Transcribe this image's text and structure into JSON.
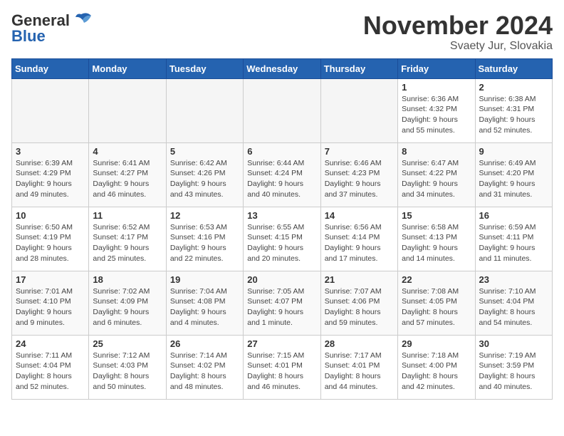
{
  "header": {
    "logo_general": "General",
    "logo_blue": "Blue",
    "month_title": "November 2024",
    "location": "Svaety Jur, Slovakia"
  },
  "weekdays": [
    "Sunday",
    "Monday",
    "Tuesday",
    "Wednesday",
    "Thursday",
    "Friday",
    "Saturday"
  ],
  "weeks": [
    [
      {
        "day": "",
        "info": ""
      },
      {
        "day": "",
        "info": ""
      },
      {
        "day": "",
        "info": ""
      },
      {
        "day": "",
        "info": ""
      },
      {
        "day": "",
        "info": ""
      },
      {
        "day": "1",
        "info": "Sunrise: 6:36 AM\nSunset: 4:32 PM\nDaylight: 9 hours\nand 55 minutes."
      },
      {
        "day": "2",
        "info": "Sunrise: 6:38 AM\nSunset: 4:31 PM\nDaylight: 9 hours\nand 52 minutes."
      }
    ],
    [
      {
        "day": "3",
        "info": "Sunrise: 6:39 AM\nSunset: 4:29 PM\nDaylight: 9 hours\nand 49 minutes."
      },
      {
        "day": "4",
        "info": "Sunrise: 6:41 AM\nSunset: 4:27 PM\nDaylight: 9 hours\nand 46 minutes."
      },
      {
        "day": "5",
        "info": "Sunrise: 6:42 AM\nSunset: 4:26 PM\nDaylight: 9 hours\nand 43 minutes."
      },
      {
        "day": "6",
        "info": "Sunrise: 6:44 AM\nSunset: 4:24 PM\nDaylight: 9 hours\nand 40 minutes."
      },
      {
        "day": "7",
        "info": "Sunrise: 6:46 AM\nSunset: 4:23 PM\nDaylight: 9 hours\nand 37 minutes."
      },
      {
        "day": "8",
        "info": "Sunrise: 6:47 AM\nSunset: 4:22 PM\nDaylight: 9 hours\nand 34 minutes."
      },
      {
        "day": "9",
        "info": "Sunrise: 6:49 AM\nSunset: 4:20 PM\nDaylight: 9 hours\nand 31 minutes."
      }
    ],
    [
      {
        "day": "10",
        "info": "Sunrise: 6:50 AM\nSunset: 4:19 PM\nDaylight: 9 hours\nand 28 minutes."
      },
      {
        "day": "11",
        "info": "Sunrise: 6:52 AM\nSunset: 4:17 PM\nDaylight: 9 hours\nand 25 minutes."
      },
      {
        "day": "12",
        "info": "Sunrise: 6:53 AM\nSunset: 4:16 PM\nDaylight: 9 hours\nand 22 minutes."
      },
      {
        "day": "13",
        "info": "Sunrise: 6:55 AM\nSunset: 4:15 PM\nDaylight: 9 hours\nand 20 minutes."
      },
      {
        "day": "14",
        "info": "Sunrise: 6:56 AM\nSunset: 4:14 PM\nDaylight: 9 hours\nand 17 minutes."
      },
      {
        "day": "15",
        "info": "Sunrise: 6:58 AM\nSunset: 4:13 PM\nDaylight: 9 hours\nand 14 minutes."
      },
      {
        "day": "16",
        "info": "Sunrise: 6:59 AM\nSunset: 4:11 PM\nDaylight: 9 hours\nand 11 minutes."
      }
    ],
    [
      {
        "day": "17",
        "info": "Sunrise: 7:01 AM\nSunset: 4:10 PM\nDaylight: 9 hours\nand 9 minutes."
      },
      {
        "day": "18",
        "info": "Sunrise: 7:02 AM\nSunset: 4:09 PM\nDaylight: 9 hours\nand 6 minutes."
      },
      {
        "day": "19",
        "info": "Sunrise: 7:04 AM\nSunset: 4:08 PM\nDaylight: 9 hours\nand 4 minutes."
      },
      {
        "day": "20",
        "info": "Sunrise: 7:05 AM\nSunset: 4:07 PM\nDaylight: 9 hours\nand 1 minute."
      },
      {
        "day": "21",
        "info": "Sunrise: 7:07 AM\nSunset: 4:06 PM\nDaylight: 8 hours\nand 59 minutes."
      },
      {
        "day": "22",
        "info": "Sunrise: 7:08 AM\nSunset: 4:05 PM\nDaylight: 8 hours\nand 57 minutes."
      },
      {
        "day": "23",
        "info": "Sunrise: 7:10 AM\nSunset: 4:04 PM\nDaylight: 8 hours\nand 54 minutes."
      }
    ],
    [
      {
        "day": "24",
        "info": "Sunrise: 7:11 AM\nSunset: 4:04 PM\nDaylight: 8 hours\nand 52 minutes."
      },
      {
        "day": "25",
        "info": "Sunrise: 7:12 AM\nSunset: 4:03 PM\nDaylight: 8 hours\nand 50 minutes."
      },
      {
        "day": "26",
        "info": "Sunrise: 7:14 AM\nSunset: 4:02 PM\nDaylight: 8 hours\nand 48 minutes."
      },
      {
        "day": "27",
        "info": "Sunrise: 7:15 AM\nSunset: 4:01 PM\nDaylight: 8 hours\nand 46 minutes."
      },
      {
        "day": "28",
        "info": "Sunrise: 7:17 AM\nSunset: 4:01 PM\nDaylight: 8 hours\nand 44 minutes."
      },
      {
        "day": "29",
        "info": "Sunrise: 7:18 AM\nSunset: 4:00 PM\nDaylight: 8 hours\nand 42 minutes."
      },
      {
        "day": "30",
        "info": "Sunrise: 7:19 AM\nSunset: 3:59 PM\nDaylight: 8 hours\nand 40 minutes."
      }
    ]
  ]
}
